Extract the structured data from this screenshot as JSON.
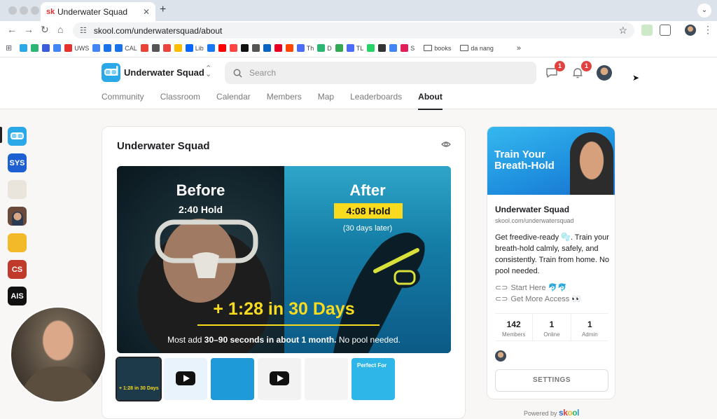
{
  "browser": {
    "tab_title": "Underwater Squad",
    "tab_favicon": "sk",
    "url": "skool.com/underwatersquad/about"
  },
  "bookmarks": [
    {
      "label": "",
      "color": "#2aa8e8"
    },
    {
      "label": "",
      "color": "#2bb673"
    },
    {
      "label": "",
      "color": "#3b5bdb"
    },
    {
      "label": "",
      "color": "#4285f4"
    },
    {
      "label": "UWS",
      "color": "#e5322d"
    },
    {
      "label": "",
      "color": "#4285f4"
    },
    {
      "label": "",
      "color": "#1a73e8"
    },
    {
      "label": "CAL",
      "color": "#1a73e8"
    },
    {
      "label": "",
      "color": "#ea4335"
    },
    {
      "label": "",
      "color": "#555555"
    },
    {
      "label": "",
      "color": "#e8453c"
    },
    {
      "label": "",
      "color": "#fbbc04"
    },
    {
      "label": "Lib",
      "color": "#0866ff"
    },
    {
      "label": "",
      "color": "#1877f2"
    },
    {
      "label": "",
      "color": "#ff0000"
    },
    {
      "label": "",
      "color": "#ff4444"
    },
    {
      "label": "",
      "color": "#111111"
    },
    {
      "label": "",
      "color": "#555555"
    },
    {
      "label": "",
      "color": "#0a66c2"
    },
    {
      "label": "",
      "color": "#e60023"
    },
    {
      "label": "",
      "color": "#ff4500"
    },
    {
      "label": "Th",
      "color": "#4a6cf7"
    },
    {
      "label": "D",
      "color": "#2bb673"
    },
    {
      "label": "",
      "color": "#34a853"
    },
    {
      "label": "TL",
      "color": "#4a6cf7"
    },
    {
      "label": "",
      "color": "#25d366"
    },
    {
      "label": "",
      "color": "#333333"
    },
    {
      "label": "",
      "color": "#4285f4"
    },
    {
      "label": "S",
      "color": "#e01e5a"
    }
  ],
  "bookmark_folders": [
    "books",
    "da nang"
  ],
  "header": {
    "group_name": "Underwater Squad",
    "search_placeholder": "Search",
    "chat_badge": "1",
    "notif_badge": "1",
    "nav": [
      "Community",
      "Classroom",
      "Calendar",
      "Members",
      "Map",
      "Leaderboards",
      "About"
    ],
    "active_nav": "About"
  },
  "rail": [
    {
      "label": "",
      "color": "#2aa8e8"
    },
    {
      "label": "SYS",
      "color": "#1d5fd1"
    },
    {
      "label": "",
      "color": "#e9e5dd"
    },
    {
      "label": "",
      "color": "#6a4a3a"
    },
    {
      "label": "",
      "color": "#f2b928"
    },
    {
      "label": "CS",
      "color": "#c0392b"
    },
    {
      "label": "AIS",
      "color": "#111111"
    }
  ],
  "main": {
    "title": "Underwater Squad",
    "hero": {
      "before": "Before",
      "before_hold": "2:40 Hold",
      "after": "After",
      "after_hold": "4:08 Hold",
      "after_sub": "(30 days later)",
      "big": "+ 1:28 in 30 Days",
      "bottom_pre": "Most add ",
      "bottom_bold": "30–90 seconds in about 1 month.",
      "bottom_post": " No pool needed."
    },
    "thumbs": [
      {
        "kind": "image",
        "color": "#1d3a4a",
        "text": "+ 1:28 in 30 Days"
      },
      {
        "kind": "video",
        "color": "#e9f3fb",
        "text": ""
      },
      {
        "kind": "image",
        "color": "#1e9ad8",
        "text": ""
      },
      {
        "kind": "video",
        "color": "#f2f2f2",
        "text": ""
      },
      {
        "kind": "image",
        "color": "#f4f4f4",
        "text": ""
      },
      {
        "kind": "image",
        "color": "#2fb6e8",
        "text": "Perfect For"
      }
    ]
  },
  "sidebar": {
    "banner_text": "Train Your Breath-Hold",
    "name": "Underwater Squad",
    "url": "skool.com/underwatersquad",
    "description": "Get freedive-ready 🫧. Train your breath-hold calmly, safely, and consistently. Train from home. No pool needed.",
    "links": [
      "Start Here 🐬🐬",
      "Get More Access 👀"
    ],
    "stats": [
      {
        "value": "142",
        "label": "Members"
      },
      {
        "value": "1",
        "label": "Online"
      },
      {
        "value": "1",
        "label": "Admin"
      }
    ],
    "settings_label": "SETTINGS"
  },
  "footer": {
    "powered_by": "Powered by",
    "brand": [
      "s",
      "k",
      "o",
      "o",
      "l"
    ]
  },
  "colors": {
    "accent_yellow": "#f8da1f",
    "skool_blue": "#2aa8e8",
    "badge_red": "#e2423f"
  }
}
